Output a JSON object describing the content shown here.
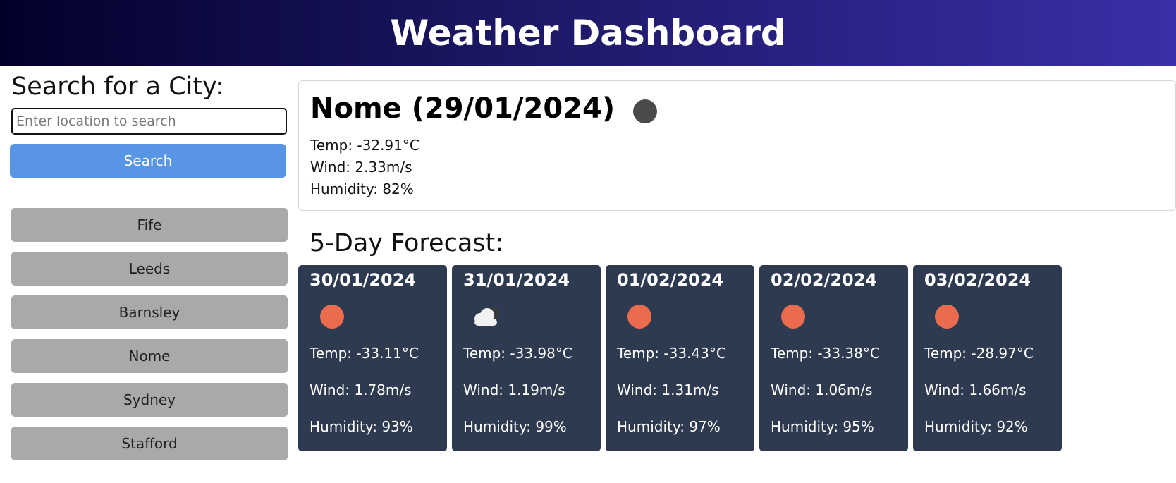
{
  "header": {
    "title": "Weather Dashboard"
  },
  "sidebar": {
    "search_title": "Search for a City:",
    "search_placeholder": "Enter location to search",
    "search_button": "Search",
    "history": [
      "Fife",
      "Leeds",
      "Barnsley",
      "Nome",
      "Sydney",
      "Stafford"
    ]
  },
  "current": {
    "title": "Nome (29/01/2024)",
    "icon": "moon-icon",
    "temp": "Temp: -32.91°C",
    "wind": "Wind: 2.33m/s",
    "humidity": "Humidity: 82%"
  },
  "forecast": {
    "title": "5-Day Forecast:",
    "days": [
      {
        "date": "30/01/2024",
        "icon": "sun-icon",
        "temp": "Temp: -33.11°C",
        "wind": "Wind: 1.78m/s",
        "humidity": "Humidity: 93%"
      },
      {
        "date": "31/01/2024",
        "icon": "cloud-icon",
        "temp": "Temp: -33.98°C",
        "wind": "Wind: 1.19m/s",
        "humidity": "Humidity: 99%"
      },
      {
        "date": "01/02/2024",
        "icon": "sun-icon",
        "temp": "Temp: -33.43°C",
        "wind": "Wind: 1.31m/s",
        "humidity": "Humidity: 97%"
      },
      {
        "date": "02/02/2024",
        "icon": "sun-icon",
        "temp": "Temp: -33.38°C",
        "wind": "Wind: 1.06m/s",
        "humidity": "Humidity: 95%"
      },
      {
        "date": "03/02/2024",
        "icon": "sun-icon",
        "temp": "Temp: -28.97°C",
        "wind": "Wind: 1.66m/s",
        "humidity": "Humidity: 92%"
      }
    ]
  },
  "colors": {
    "header_start": "#02002a",
    "header_end": "#3a2fa8",
    "search_button": "#5895e4",
    "history_button": "#a9a9a9",
    "card_bg": "#2e3a50",
    "sun": "#ea6b4e"
  }
}
